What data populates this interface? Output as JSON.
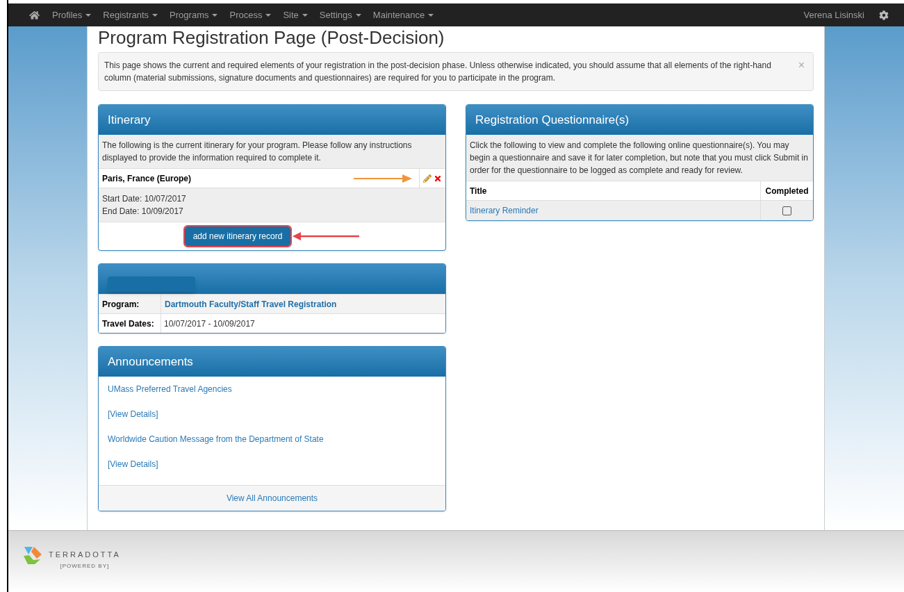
{
  "nav": {
    "items": [
      {
        "label": "Profiles"
      },
      {
        "label": "Registrants"
      },
      {
        "label": "Programs"
      },
      {
        "label": "Process"
      },
      {
        "label": "Site"
      },
      {
        "label": "Settings"
      },
      {
        "label": "Maintenance"
      }
    ],
    "user": "Verena Lisinski"
  },
  "page_title": "Program Registration Page (Post-Decision)",
  "alert": {
    "text": "This page shows the current and required elements of your registration in the post-decision phase. Unless otherwise indicated, you should assume that all elements of the right-hand column (material submissions, signature documents and questionnaires) are required for you to participate in the program.",
    "close": "×"
  },
  "itinerary": {
    "title": "Itinerary",
    "intro": "The following is the current itinerary for your program. Please follow any instructions displayed to provide the information required to complete it.",
    "records": [
      {
        "place": "Paris, France (Europe)",
        "start": "Start Date: 10/07/2017",
        "end": "End Date: 10/09/2017"
      }
    ],
    "add_button": {
      "label": "add new itinerary record",
      "highlighted": true
    }
  },
  "program": {
    "rows": [
      {
        "label": "Program:",
        "value": "Dartmouth Faculty/Staff Travel Registration",
        "kind": "link"
      },
      {
        "label": "Travel Dates:",
        "value": "10/07/2017 - 10/09/2017",
        "kind": "text"
      }
    ]
  },
  "announcements": {
    "title": "Announcements",
    "items": [
      {
        "text": "UMass Preferred Travel Agencies"
      },
      {
        "text": "[View Details]"
      },
      {
        "text": "Worldwide Caution Message from the Department of State"
      },
      {
        "text": "[View Details]"
      }
    ],
    "footer_link": "View All Announcements"
  },
  "questionnaire": {
    "title": "Registration Questionnaire(s)",
    "intro": "Click the following to view and complete the following online questionnaire(s). You may begin a questionnaire and save it for later completion, but note that you must click Submit in order for the questionnaire to be logged as complete and ready for review.",
    "columns": [
      "Title",
      "Completed"
    ],
    "rows": [
      {
        "title": "Itinerary Reminder",
        "completed": false
      }
    ]
  },
  "footer": {
    "brand": "TERRADOTTA",
    "tagline": "[POWERED BY]"
  }
}
